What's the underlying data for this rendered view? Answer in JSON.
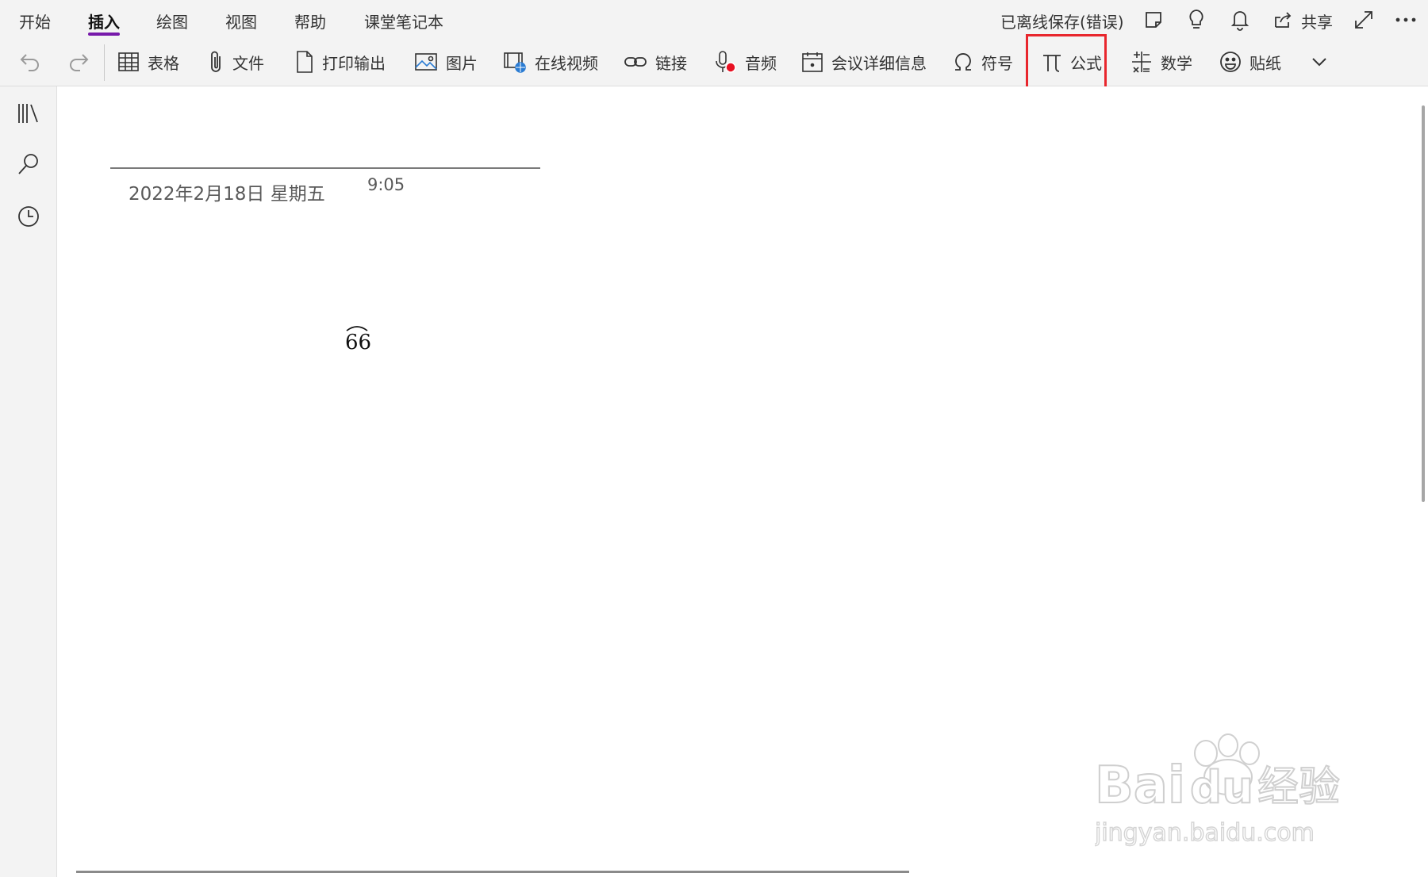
{
  "tabs": [
    {
      "label": "开始"
    },
    {
      "label": "插入"
    },
    {
      "label": "绘图"
    },
    {
      "label": "视图"
    },
    {
      "label": "帮助"
    },
    {
      "label": "课堂笔记本"
    }
  ],
  "status": {
    "text": "已离线保存(错误)"
  },
  "share": {
    "label": "共享"
  },
  "toolbar": {
    "table": "表格",
    "file": "文件",
    "printout": "打印输出",
    "picture": "图片",
    "online_video": "在线视频",
    "link": "链接",
    "audio": "音频",
    "meeting": "会议详细信息",
    "symbol": "符号",
    "equation": "公式",
    "math": "数学",
    "sticker": "贴纸"
  },
  "page": {
    "date": "2022年2月18日 星期五",
    "time": "9:05",
    "formula": "66"
  },
  "watermark": {
    "brand": "Bai du 经验",
    "url": "jingyan.baidu.com"
  },
  "colors": {
    "accent": "#7719aa",
    "highlight": "#e8262d"
  }
}
